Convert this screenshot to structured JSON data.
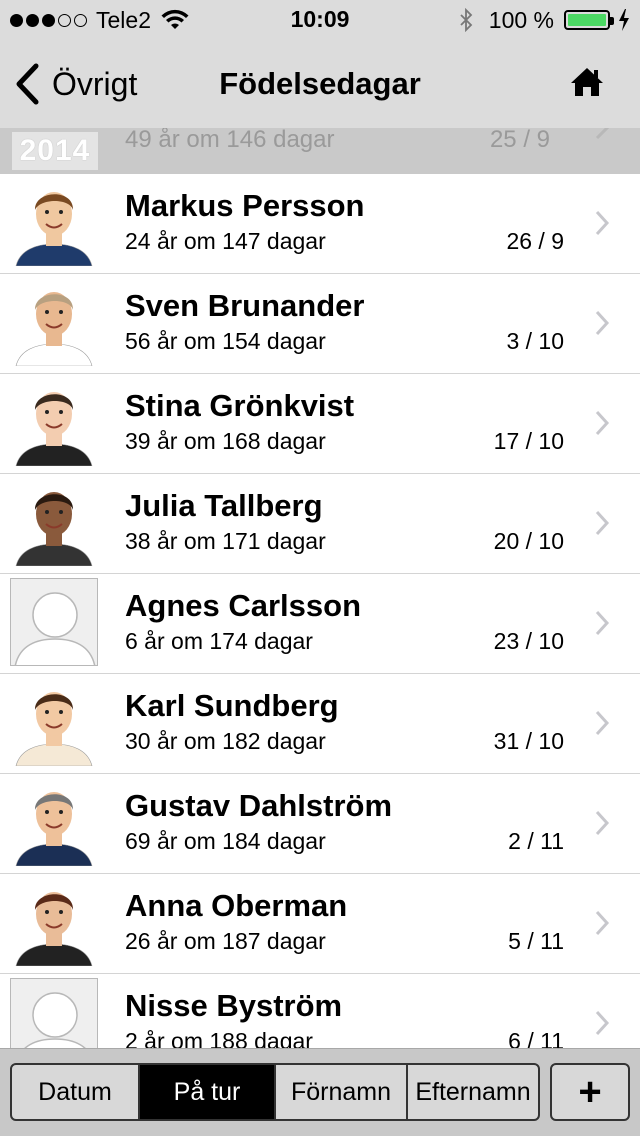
{
  "status_bar": {
    "carrier": "Tele2",
    "time": "10:09",
    "battery_percent": "100 %",
    "signal_bars_filled": 3,
    "signal_bars_total": 5,
    "battery_color": "#4cd964"
  },
  "nav": {
    "back_label": "Övrigt",
    "title": "Födelsedagar",
    "home_icon": "home-icon"
  },
  "section": {
    "year": "2014",
    "ghost_sub": "49 år om 146 dagar",
    "ghost_date": "25 / 9"
  },
  "people": [
    {
      "name": "Markus Persson",
      "sub": "24 år om 147 dagar",
      "date": "26 / 9",
      "avatar": "photo"
    },
    {
      "name": "Sven Brunander",
      "sub": "56 år om 154 dagar",
      "date": "3 / 10",
      "avatar": "photo"
    },
    {
      "name": "Stina Grönkvist",
      "sub": "39 år om 168 dagar",
      "date": "17 / 10",
      "avatar": "photo"
    },
    {
      "name": "Julia Tallberg",
      "sub": "38 år om 171 dagar",
      "date": "20 / 10",
      "avatar": "photo"
    },
    {
      "name": "Agnes Carlsson",
      "sub": "6 år om 174 dagar",
      "date": "23 / 10",
      "avatar": "placeholder"
    },
    {
      "name": "Karl Sundberg",
      "sub": "30 år om 182 dagar",
      "date": "31 / 10",
      "avatar": "photo"
    },
    {
      "name": "Gustav Dahlström",
      "sub": "69 år om 184 dagar",
      "date": "2 / 11",
      "avatar": "photo"
    },
    {
      "name": "Anna Oberman",
      "sub": "26 år om 187 dagar",
      "date": "5 / 11",
      "avatar": "photo"
    },
    {
      "name": "Nisse Byström",
      "sub": "2 år om 188 dagar",
      "date": "6 / 11",
      "avatar": "placeholder"
    }
  ],
  "toolbar": {
    "segments": [
      "Datum",
      "På tur",
      "Förnamn",
      "Efternamn"
    ],
    "active_segment": "På tur",
    "add_label": "+"
  }
}
